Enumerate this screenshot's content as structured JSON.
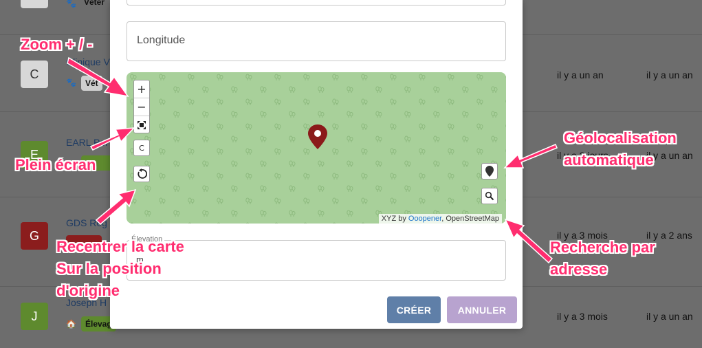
{
  "background": {
    "rows": [
      {
        "avatar": "",
        "name": "",
        "tag": "Vétér",
        "time1": "",
        "time2": ""
      },
      {
        "avatar": "C",
        "name": "Clinique V",
        "tag": "Vét",
        "time1": "il y a un an",
        "time2": "il y a un an"
      },
      {
        "avatar": "E",
        "name": "EARL Por",
        "tag": "",
        "time1": "il y a 2 jours",
        "time2": "il y a un an"
      },
      {
        "avatar": "G",
        "name": "GDS Rég",
        "tag": "",
        "time1": "il y a 3 mois",
        "time2": "il y a 2 ans"
      },
      {
        "avatar": "J",
        "name": "Joseph H",
        "tag": "Élevag",
        "time1": "il y a 3 mois",
        "time2": "il y a un an"
      }
    ],
    "colors": {
      "C": "#d8d8d8",
      "E": "#5e8a2e",
      "G": "#8b1d1d",
      "J": "#5e8a2e"
    }
  },
  "modal": {
    "longitude_placeholder": "Longitude",
    "map": {
      "zoom_in_label": "+",
      "zoom_out_label": "−",
      "fullscreen_icon": "fullscreen-icon",
      "center_label": "C",
      "recenter_icon": "reset-rotate-icon",
      "geolocate_icon": "pin-icon",
      "search_icon": "magnifier-icon",
      "attribution_prefix": "XYZ by ",
      "attribution_link": "Ooopener",
      "attribution_suffix": ", OpenStreetMap",
      "marker_color": "#8b1a1a"
    },
    "elevation_label": "Élevation",
    "elevation_unit": "m",
    "create_label": "CRÉER",
    "cancel_label": "ANNULER"
  },
  "annotations": {
    "zoom": "Zoom + / -",
    "fullscreen": "Plein écran",
    "recenter_line1": "Recentrer la carte",
    "recenter_line2": "Sur la position",
    "recenter_line3": "d'origine",
    "geoloc_line1": "Géolocalisation",
    "geoloc_line2": "automatique",
    "search_line1": "Recherche par",
    "search_line2": "adresse",
    "color": "#ff2d6f"
  }
}
